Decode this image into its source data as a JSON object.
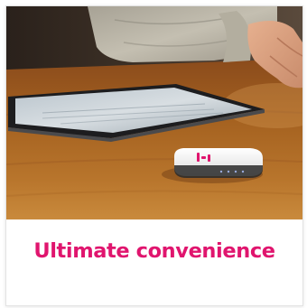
{
  "card": {
    "title": "Ultimate convenience",
    "title_color": "#e0156e",
    "image": {
      "subject": "hand above a tablet and a white portable hotspot device on a wooden table",
      "device_logo_color": "#e0156e"
    }
  }
}
